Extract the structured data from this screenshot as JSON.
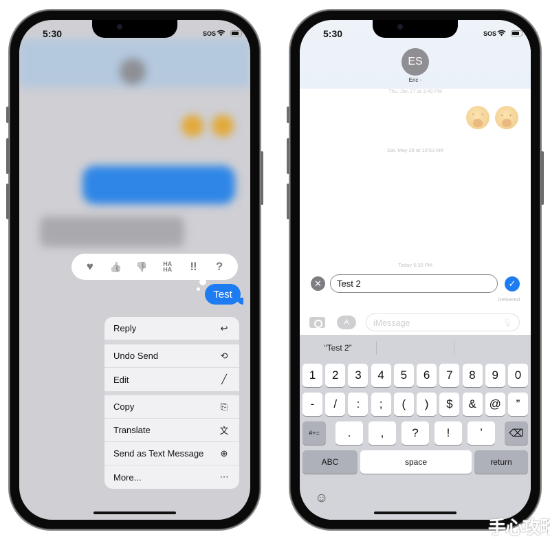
{
  "left_phone": {
    "status": {
      "time": "5:30",
      "carrier": "SOS"
    },
    "tapback": {
      "reactions": [
        {
          "name": "heart",
          "glyph": "♥"
        },
        {
          "name": "thumbs-up",
          "glyph": "👍"
        },
        {
          "name": "thumbs-down",
          "glyph": "👎"
        },
        {
          "name": "haha",
          "glyph": "HA HA"
        },
        {
          "name": "exclamation",
          "glyph": "‼"
        },
        {
          "name": "question",
          "glyph": "?"
        }
      ]
    },
    "selected_message": {
      "text": "Test",
      "color": "#1e7cf2"
    },
    "menu": {
      "groups": [
        [
          {
            "label": "Reply",
            "icon": "reply-icon",
            "glyph": "↩"
          }
        ],
        [
          {
            "label": "Undo Send",
            "icon": "undo-icon",
            "glyph": "⟲"
          },
          {
            "label": "Edit",
            "icon": "pencil-icon",
            "glyph": "╱"
          }
        ],
        [
          {
            "label": "Copy",
            "icon": "copy-icon",
            "glyph": "⎘"
          },
          {
            "label": "Translate",
            "icon": "translate-icon",
            "glyph": "文"
          },
          {
            "label": "Send as Text Message",
            "icon": "send-arrow-icon",
            "glyph": "⊕"
          },
          {
            "label": "More...",
            "icon": "more-icon",
            "glyph": "⋯"
          }
        ]
      ]
    }
  },
  "right_phone": {
    "status": {
      "time": "5:30",
      "carrier": "SOS"
    },
    "contact": {
      "initials": "ES",
      "name": "Eric",
      "chevron": "›"
    },
    "timestamps": [
      "Thu, Jan 27 at 3:49 PM",
      "Sat, May 28 at 10:53 AM",
      "Today 5:30 PM"
    ],
    "emoji_message": [
      "🤭",
      "🫢"
    ],
    "edit": {
      "value": "Test 2",
      "cancel_glyph": "✕",
      "confirm_glyph": "✓",
      "status": "Delivered"
    },
    "compose": {
      "placeholder": "iMessage",
      "apps_glyph": "A",
      "mic_glyph": "🎙"
    },
    "keyboard": {
      "suggestions": [
        "“Test 2”",
        "",
        ""
      ],
      "row1": [
        "1",
        "2",
        "3",
        "4",
        "5",
        "6",
        "7",
        "8",
        "9",
        "0"
      ],
      "row2": [
        "-",
        "/",
        ":",
        ";",
        "(",
        ")",
        "$",
        "&",
        "@",
        "”"
      ],
      "row3": {
        "shift": "#+=",
        "keys": [
          ".",
          ",",
          "?",
          "!",
          "’"
        ],
        "delete": "⌫"
      },
      "row4": {
        "abc": "ABC",
        "space": "space",
        "return": "return"
      },
      "emoji_glyph": "☺"
    }
  },
  "watermark": "手心攻略"
}
